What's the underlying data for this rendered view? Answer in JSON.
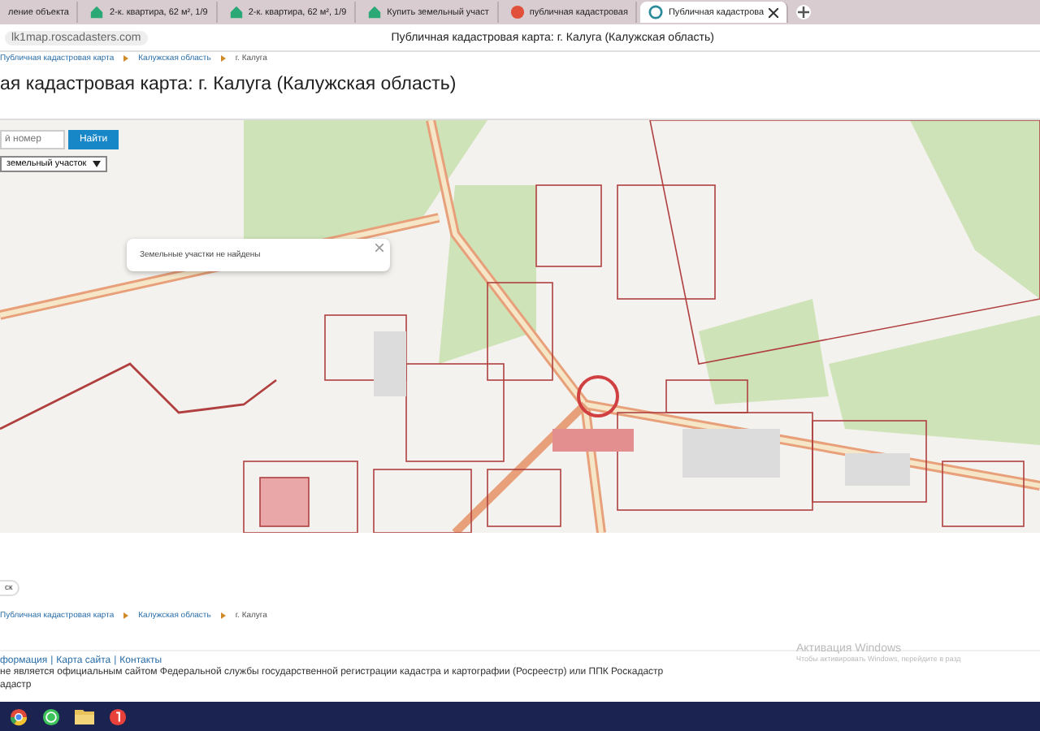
{
  "browser": {
    "tabs": [
      {
        "label": "ление объекта",
        "selected": false,
        "kind": "plain"
      },
      {
        "label": "2-к. квартира, 62 м², 1/9",
        "selected": false,
        "kind": "house"
      },
      {
        "label": "2-к. квартира, 62 м², 1/9",
        "selected": false,
        "kind": "house"
      },
      {
        "label": "Купить земельный участ",
        "selected": false,
        "kind": "house"
      },
      {
        "label": "публичная кадастровая",
        "selected": false,
        "kind": "red"
      },
      {
        "label": "Публичная кадастрова",
        "selected": true,
        "kind": "globe"
      }
    ],
    "address": "lk1map.roscadasters.com",
    "page_title": "Публичная кадастровая карта: г. Калуга (Калужская область)"
  },
  "breadcrumb_top": [
    "Публичная кадастровая карта",
    "Калужская область",
    "г. Калуга"
  ],
  "heading": "ая кадастровая карта: г. Калуга (Калужская область)",
  "map": {
    "search_placeholder": "й номер",
    "search_button": "Найти",
    "type_select": "земельный участок",
    "popup": "Земельные участки не найдены"
  },
  "back_button": "ск",
  "breadcrumb_bottom": [
    "Публичная кадастровая карта",
    "Калужская область",
    "г. Калуга"
  ],
  "footer": {
    "links": [
      "формация",
      "Карта сайта",
      "Контакты"
    ],
    "separator": "|",
    "notice": "не является официальным сайтом Федеральной службы государственной регистрации кадастра и картографии (Росреестр) или ППК Роскадастр",
    "notice_2": "адастр"
  },
  "activation": {
    "title": "Активация Windows",
    "text": "Чтобы активировать Windows, перейдите в разд"
  }
}
